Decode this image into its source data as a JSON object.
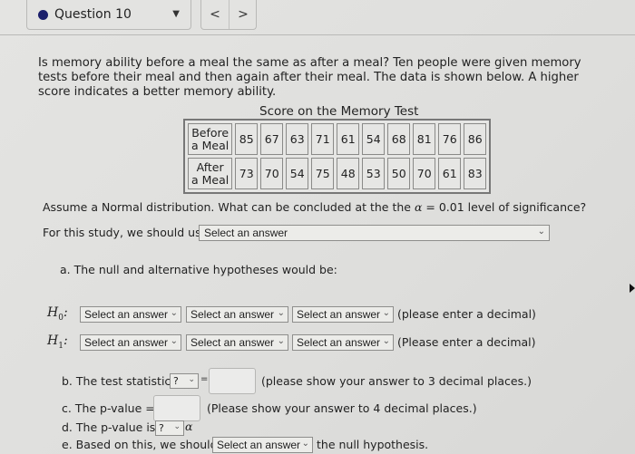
{
  "header": {
    "question_label": "Question 10",
    "question_dot_color": "#1b1f6b",
    "caret_icon": "▼",
    "prev_icon": "<",
    "next_icon": ">"
  },
  "question": {
    "text": "Is memory ability before a meal the same as after a meal?  Ten people were given memory tests before their meal and then again after their meal. The data is shown below. A higher score indicates a better memory ability."
  },
  "table": {
    "title": "Score on the Memory Test",
    "rows": [
      {
        "label_line1": "Before",
        "label_line2": "a Meal",
        "values": [
          "85",
          "67",
          "63",
          "71",
          "61",
          "54",
          "68",
          "81",
          "76",
          "86"
        ]
      },
      {
        "label_line1": "After",
        "label_line2": "a Meal",
        "values": [
          "73",
          "70",
          "54",
          "75",
          "48",
          "53",
          "50",
          "70",
          "61",
          "83"
        ]
      }
    ]
  },
  "assumption": {
    "prefix": "Assume a Normal distribution.  What can be concluded at the the ",
    "alpha_symbol": "α",
    "suffix": " = 0.01 level of significance?"
  },
  "study_use": {
    "label": "For this study, we should use",
    "select_value": "Select an answer"
  },
  "part_a": {
    "label": "a. The null and alternative hypotheses would be:",
    "h0": {
      "symbol": "H",
      "sub": "0",
      "colon": ":",
      "selects": [
        "Select an answer",
        "Select an answer",
        "Select an answer"
      ],
      "note": "(please enter a decimal)"
    },
    "h1": {
      "symbol": "H",
      "sub": "1",
      "colon": ":",
      "selects": [
        "Select an answer",
        "Select an answer",
        "Select an answer"
      ],
      "note": "(Please enter a decimal)"
    }
  },
  "part_b": {
    "label": "b. The test statistic",
    "select_value": "?",
    "equals": "=",
    "input_value": "",
    "note": "(please show your answer to 3 decimal places.)"
  },
  "part_c": {
    "label": "c. The p-value =",
    "input_value": "",
    "note": "(Please show your answer to 4 decimal places.)"
  },
  "part_d": {
    "label": "d. The p-value is",
    "select_value": "?",
    "alpha_symbol": "α"
  },
  "part_e": {
    "label": "e. Based on this, we should",
    "select_value": "Select an answer",
    "suffix": "the null hypothesis."
  },
  "icons": {
    "chevron": "⌄"
  }
}
